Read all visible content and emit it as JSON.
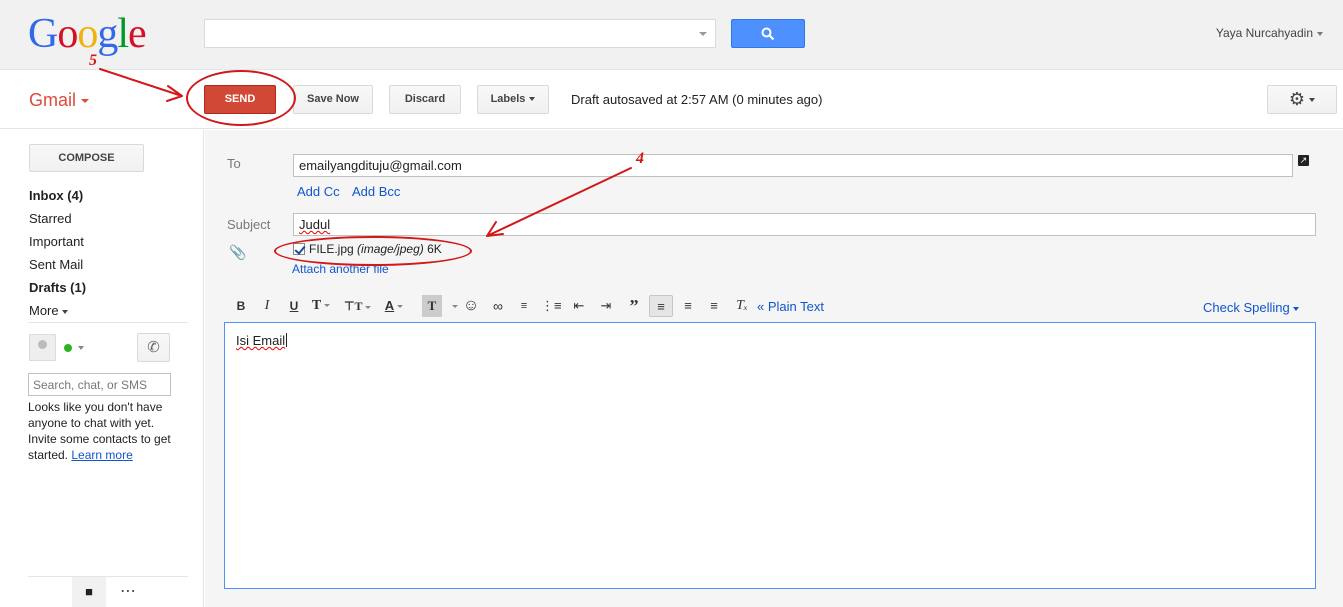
{
  "header": {
    "logo_letters": [
      {
        "ch": "G",
        "color": "#3369e8"
      },
      {
        "ch": "o",
        "color": "#d50f25"
      },
      {
        "ch": "o",
        "color": "#eeb211"
      },
      {
        "ch": "g",
        "color": "#3369e8"
      },
      {
        "ch": "l",
        "color": "#009925"
      },
      {
        "ch": "e",
        "color": "#d50f25"
      }
    ],
    "search_value": "",
    "user_name": "Yaya Nurcahyadin"
  },
  "toolbar": {
    "app_label": "Gmail",
    "send_label": "SEND",
    "save_label": "Save Now",
    "discard_label": "Discard",
    "labels_label": "Labels",
    "autosave_text": "Draft autosaved at 2:57 AM (0 minutes ago)"
  },
  "annotations": {
    "step_send": "5",
    "step_attachment": "4",
    "color": "#d21818"
  },
  "sidebar": {
    "compose_label": "COMPOSE",
    "items": [
      {
        "label": "Inbox (4)",
        "bold": true
      },
      {
        "label": "Starred",
        "bold": false
      },
      {
        "label": "Important",
        "bold": false
      },
      {
        "label": "Sent Mail",
        "bold": false
      },
      {
        "label": "Drafts (1)",
        "bold": true
      },
      {
        "label": "More",
        "bold": false
      }
    ],
    "chat_search_placeholder": "Search, chat, or SMS",
    "chat_message": "Looks like you don't have anyone to chat with yet. Invite some contacts to get started.",
    "learn_more": "Learn more"
  },
  "compose": {
    "to_label": "To",
    "to_value": "emailyangdituju@gmail.com",
    "add_cc": "Add Cc",
    "add_bcc": "Add Bcc",
    "subject_label": "Subject",
    "subject_value": "Judul",
    "attachment_name": "FILE.jpg",
    "attachment_type": "(image/jpeg)",
    "attachment_size": "6K",
    "attach_another": "Attach another file",
    "plain_text_link": "« Plain Text",
    "check_spelling": "Check Spelling",
    "body_text": "Isi Email"
  },
  "colors": {
    "send_button": "#d14836",
    "search_button": "#4d90fe",
    "link": "#1155cc",
    "gmail_red": "#dd4b39"
  }
}
